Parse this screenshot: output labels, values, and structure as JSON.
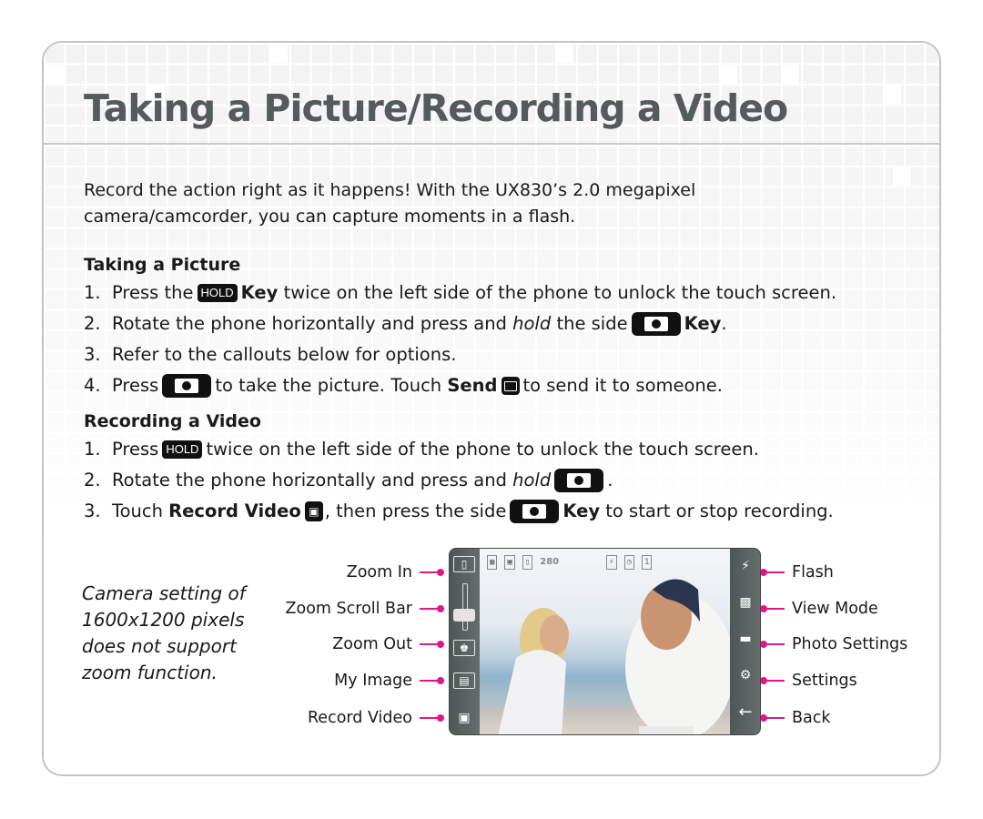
{
  "title": "Taking a Picture/Recording a Video",
  "intro": {
    "line1": "Record the action right as it happens! With the UX830’s 2.0 megapixel",
    "line2": "camera/camcorder, you can capture moments in a flash."
  },
  "taking_picture": {
    "heading": "Taking a Picture",
    "steps": [
      {
        "num": "1.",
        "a": "Press the",
        "hold": "HOLD",
        "key": "Key",
        "b": "twice on the left side of the phone to unlock the touch screen."
      },
      {
        "num": "2.",
        "a": "Rotate the phone horizontally and press and",
        "em": "hold",
        "b": "the side",
        "key": "Key",
        "c": "."
      },
      {
        "num": "3.",
        "a": "Refer to the callouts below for options."
      },
      {
        "num": "4.",
        "a": "Press",
        "b": "to take the picture. Touch",
        "send": "Send",
        "c": "to send it to someone."
      }
    ]
  },
  "recording_video": {
    "heading": "Recording a Video",
    "steps": [
      {
        "num": "1.",
        "a": "Press",
        "hold": "HOLD",
        "b": "twice on the left side of the phone to unlock the touch screen."
      },
      {
        "num": "2.",
        "a": "Rotate the phone horizontally and press and",
        "em": "hold",
        "c": "."
      },
      {
        "num": "3.",
        "a": "Touch",
        "record": "Record Video",
        "b": ", then press the side",
        "key": "Key",
        "c": "to start or stop recording."
      }
    ]
  },
  "note": {
    "line1": "Camera setting of",
    "line2": "1600x1200 pixels",
    "line3": "does not support",
    "line4": "zoom function."
  },
  "callouts_left": [
    "Zoom In",
    "Zoom Scroll Bar",
    "Zoom Out",
    "My Image",
    "Record Video"
  ],
  "callouts_right": [
    "Flash",
    "View Mode",
    "Photo Settings",
    "Settings",
    "Back"
  ],
  "phone_screen": {
    "shots_remaining": "280"
  },
  "colors": {
    "callout_line": "#e0178a",
    "title": "#555b5c"
  }
}
